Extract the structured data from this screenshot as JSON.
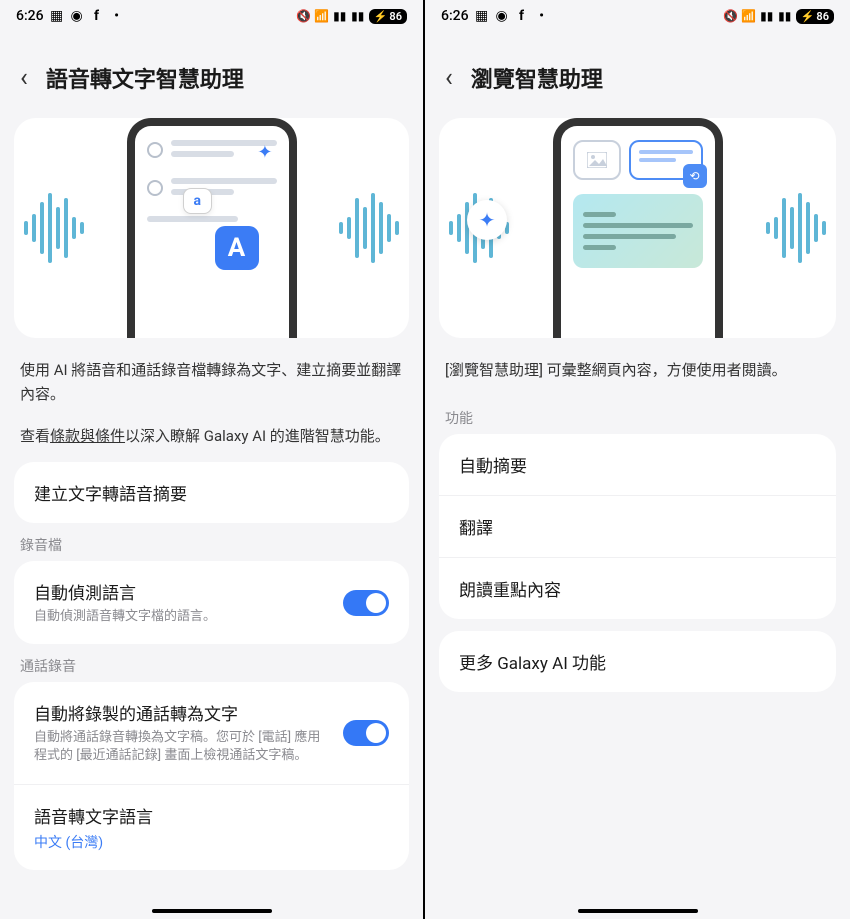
{
  "status": {
    "time": "6:26",
    "battery": "86"
  },
  "left": {
    "title": "語音轉文字智慧助理",
    "desc1": "使用 AI 將語音和通話錄音檔轉錄為文字、建立摘要並翻譯內容。",
    "desc2_pre": "查看",
    "desc2_link": "條款與條件",
    "desc2_post": "以深入瞭解 Galaxy AI 的進階智慧功能。",
    "item1_title": "建立文字轉語音摘要",
    "section1": "錄音檔",
    "item2_title": "自動偵測語言",
    "item2_sub": "自動偵測語音轉文字檔的語言。",
    "section2": "通話錄音",
    "item3_title": "自動將錄製的通話轉為文字",
    "item3_sub": "自動將通話錄音轉換為文字稿。您可於 [電話] 應用程式的 [最近通話記錄] 畫面上檢視通話文字稿。",
    "item4_title": "語音轉文字語言",
    "item4_value": "中文 (台灣)"
  },
  "right": {
    "title": "瀏覽智慧助理",
    "desc": "[瀏覽智慧助理] 可彙整網頁內容，方便使用者閱讀。",
    "section": "功能",
    "item1": "自動摘要",
    "item2": "翻譯",
    "item3": "朗讀重點內容",
    "item4": "更多 Galaxy AI 功能"
  }
}
